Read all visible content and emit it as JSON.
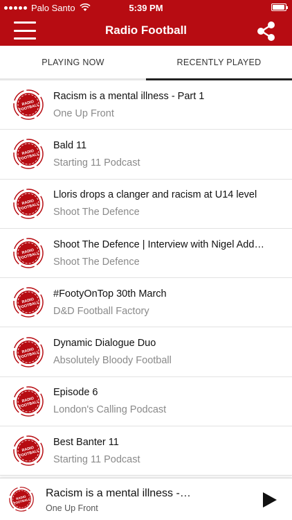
{
  "status": {
    "carrier": "Palo Santo",
    "time": "5:39 PM",
    "battery_level": 0.92
  },
  "header": {
    "title": "Radio Football"
  },
  "tabs": [
    {
      "label": "PLAYING NOW",
      "active": false
    },
    {
      "label": "RECENTLY PLAYED",
      "active": true
    }
  ],
  "logo": {
    "text_top": "RADIO",
    "text_bottom": "FOOTBALL",
    "color": "#b70c12"
  },
  "recent": [
    {
      "title": "Racism is a mental illness - Part 1",
      "podcast": "One Up Front"
    },
    {
      "title": "Bald 11",
      "podcast": "Starting 11 Podcast"
    },
    {
      "title": "Lloris drops a clanger and racism at U14 level",
      "podcast": "Shoot The Defence"
    },
    {
      "title": "Shoot The Defence | Interview with Nigel Add…",
      "podcast": "Shoot The Defence"
    },
    {
      "title": "#FootyOnTop 30th March",
      "podcast": "D&D Football Factory"
    },
    {
      "title": "Dynamic Dialogue Duo",
      "podcast": "Absolutely Bloody Football"
    },
    {
      "title": "Episode 6",
      "podcast": "London's Calling Podcast"
    },
    {
      "title": "Best Banter 11",
      "podcast": "Starting 11 Podcast"
    }
  ],
  "player": {
    "title": "Racism is a mental illness -…",
    "podcast": "One Up Front"
  },
  "colors": {
    "brand": "#b70c12"
  }
}
